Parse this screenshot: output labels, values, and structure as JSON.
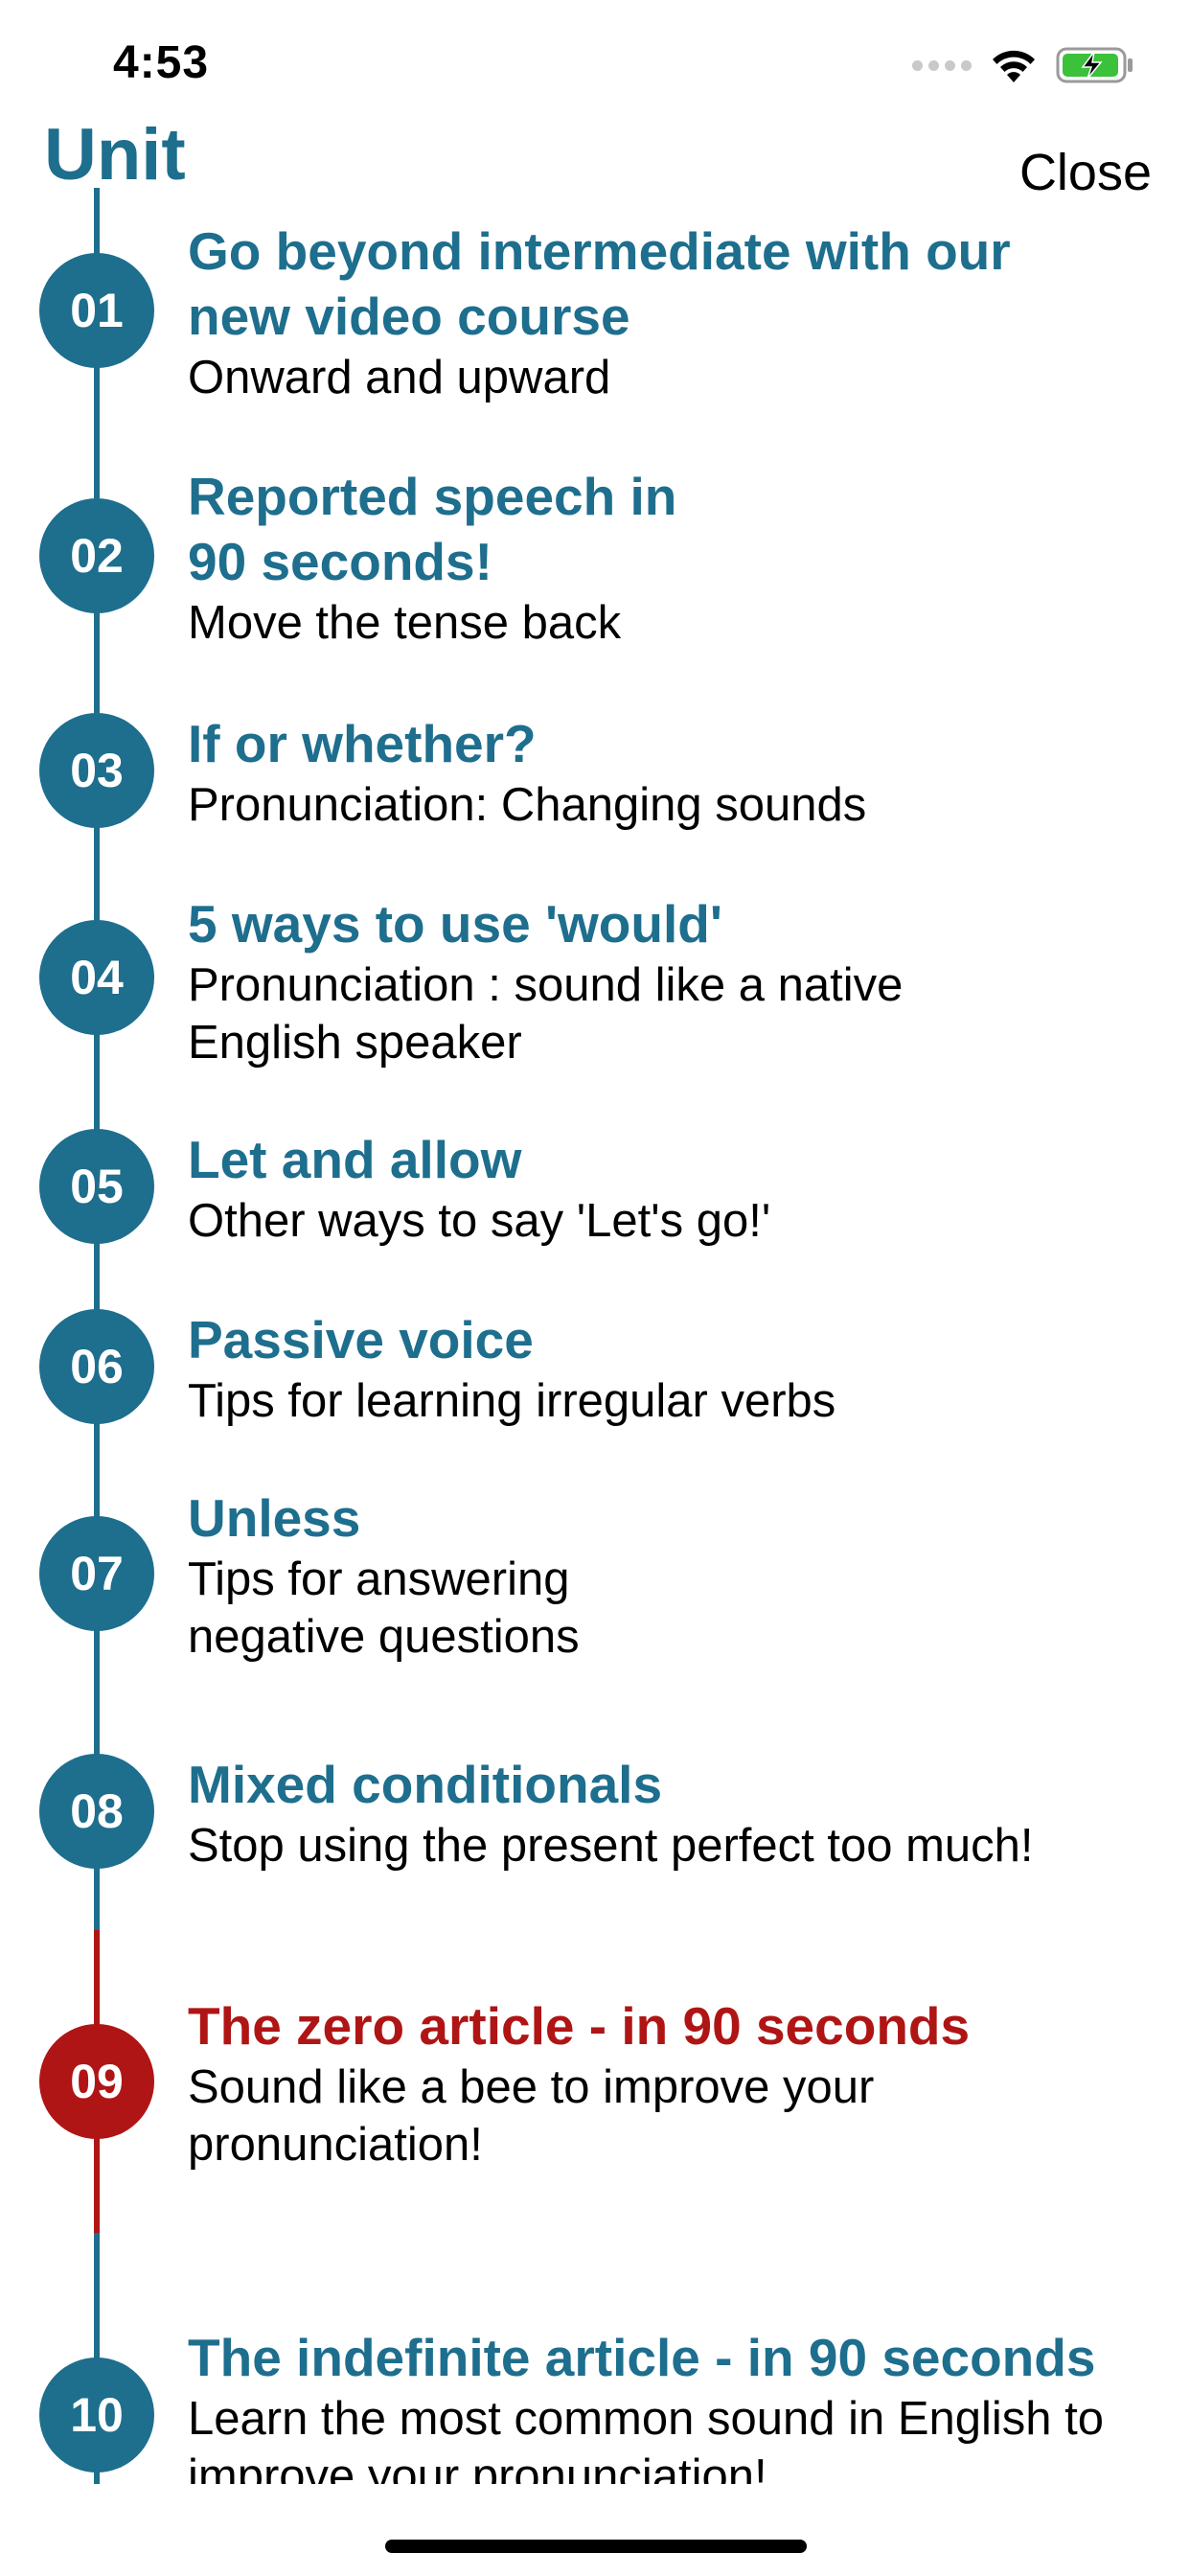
{
  "status_bar": {
    "time": "4:53"
  },
  "header": {
    "title": "Unit",
    "close_label": "Close"
  },
  "units": [
    {
      "number": "01",
      "title_lines": [
        "Go beyond intermediate with our",
        "new video course"
      ],
      "subtitle_lines": [
        "Onward and upward"
      ]
    },
    {
      "number": "02",
      "title_lines": [
        "Reported speech in",
        "90 seconds!"
      ],
      "subtitle_lines": [
        "Move the tense back"
      ]
    },
    {
      "number": "03",
      "title_lines": [
        "If or whether?"
      ],
      "subtitle_lines": [
        "Pronunciation: Changing sounds"
      ]
    },
    {
      "number": "04",
      "title_lines": [
        "5 ways to use 'would'"
      ],
      "subtitle_lines": [
        "Pronunciation : sound like a native",
        "English speaker"
      ]
    },
    {
      "number": "05",
      "title_lines": [
        "Let and allow"
      ],
      "subtitle_lines": [
        "Other ways to say 'Let's go!'"
      ]
    },
    {
      "number": "06",
      "title_lines": [
        "Passive voice"
      ],
      "subtitle_lines": [
        "Tips for learning irregular verbs"
      ]
    },
    {
      "number": "07",
      "title_lines": [
        "Unless"
      ],
      "subtitle_lines": [
        "Tips for answering",
        "negative questions"
      ]
    },
    {
      "number": "08",
      "title_lines": [
        "Mixed conditionals"
      ],
      "subtitle_lines": [
        "Stop using the present perfect too much!"
      ]
    },
    {
      "number": "09",
      "title_lines": [
        "The zero article - in 90 seconds"
      ],
      "subtitle_lines": [
        "Sound like a bee to improve your",
        "pronunciation!"
      ],
      "active": true
    },
    {
      "number": "10",
      "title_lines": [
        "The indefinite article - in 90 seconds"
      ],
      "subtitle_lines": [
        "Learn the most common sound in English to",
        "improve your pronunciation!"
      ]
    }
  ],
  "colors": {
    "accent": "#1e6e8e",
    "active": "#b01515"
  }
}
